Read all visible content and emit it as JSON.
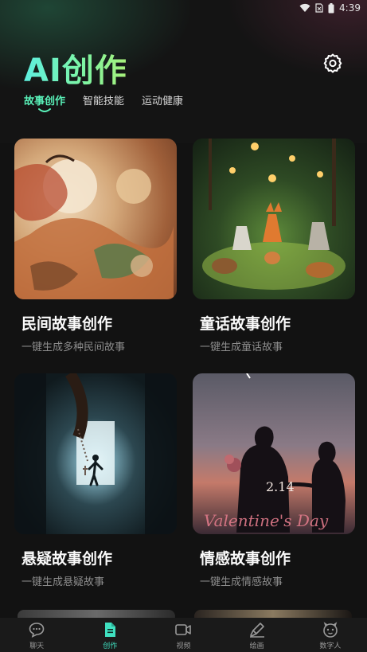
{
  "status_bar": {
    "time": "4:39"
  },
  "header": {
    "title": "AI创作"
  },
  "tabs": [
    {
      "label": "故事创作",
      "active": true
    },
    {
      "label": "智能技能",
      "active": false
    },
    {
      "label": "运动健康",
      "active": false
    }
  ],
  "cards": [
    {
      "title": "民间故事创作",
      "desc": "一键生成多种民间故事"
    },
    {
      "title": "童话故事创作",
      "desc": "一键生成童话故事"
    },
    {
      "title": "悬疑故事创作",
      "desc": "一键生成悬疑故事"
    },
    {
      "title": "情感故事创作",
      "desc": "一键生成情感故事",
      "image_text_date": "2.14",
      "image_text_script": "Valentine's Day"
    }
  ],
  "bottom_nav": [
    {
      "label": "聊天",
      "icon": "chat-bubble-icon",
      "active": false
    },
    {
      "label": "创作",
      "icon": "document-icon",
      "active": true
    },
    {
      "label": "视频",
      "icon": "video-camera-icon",
      "active": false
    },
    {
      "label": "绘画",
      "icon": "paint-brush-icon",
      "active": false
    },
    {
      "label": "数字人",
      "icon": "robot-face-icon",
      "active": false
    }
  ],
  "colors": {
    "accent": "#3fe0c0",
    "background": "#121212",
    "tab_active": "#59f0b8"
  }
}
